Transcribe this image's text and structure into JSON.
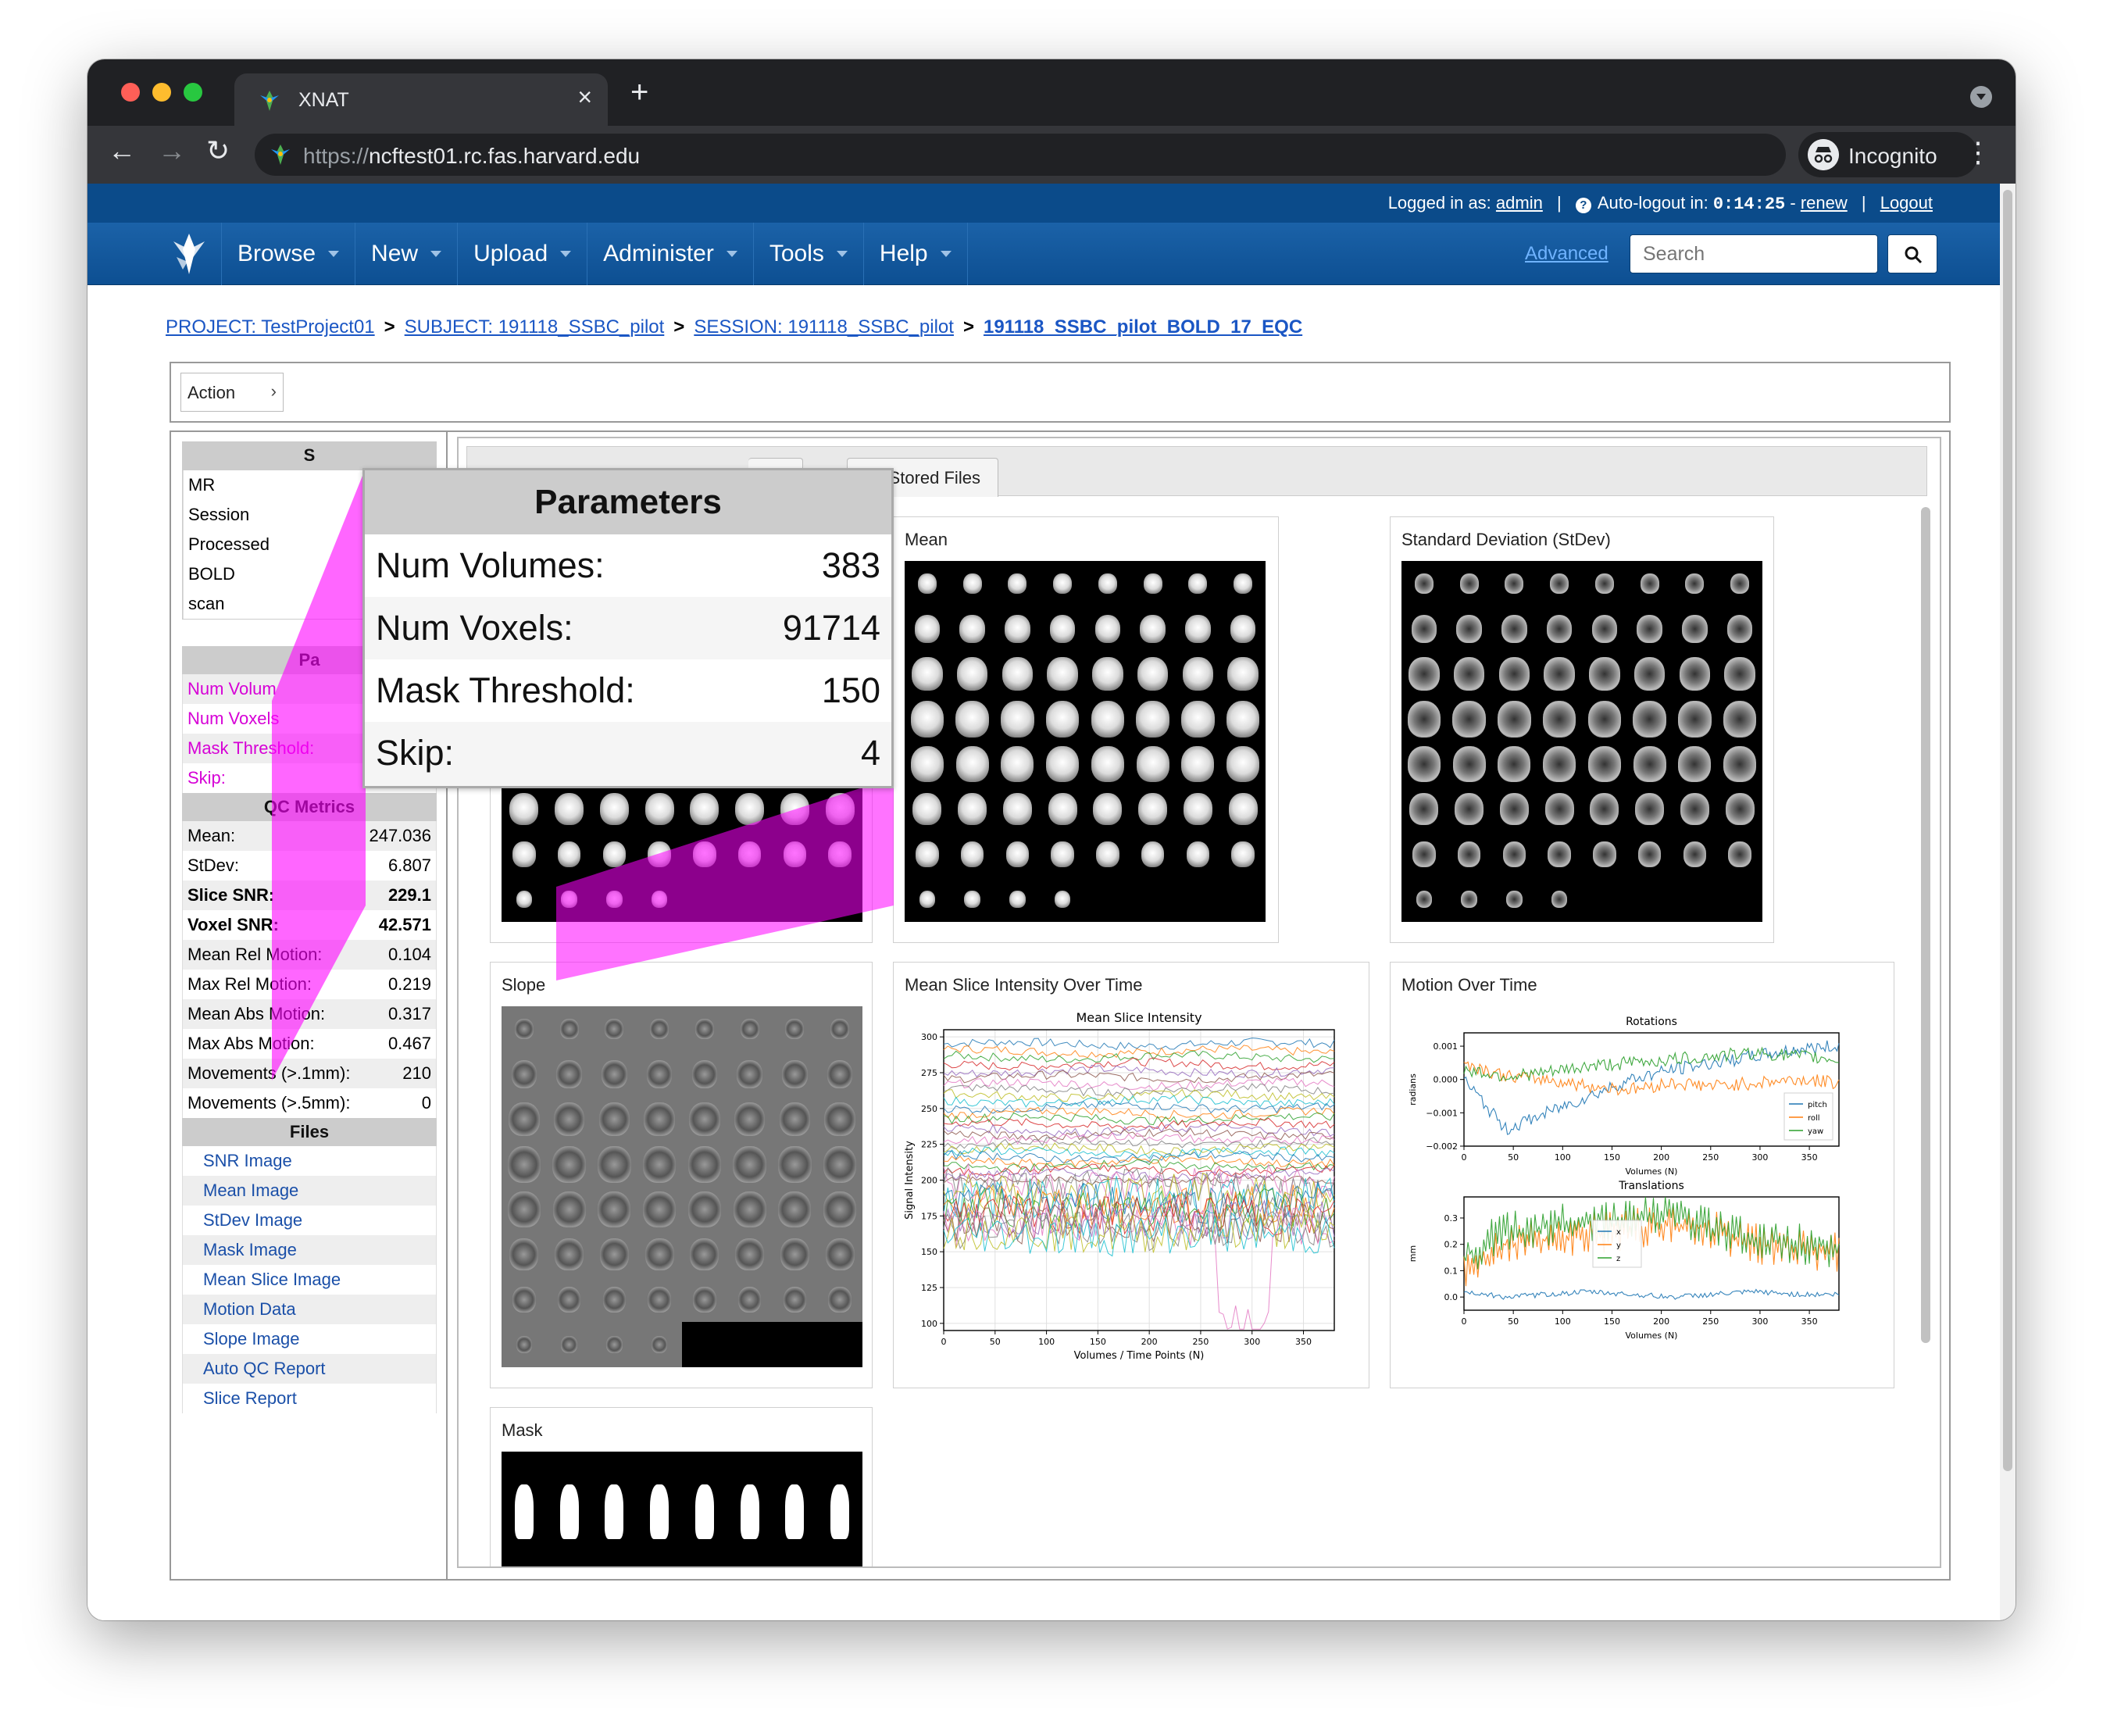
{
  "browser": {
    "tab_title": "XNAT",
    "url_scheme": "https://",
    "url_host": "ncftest01.rc.fas.harvard.edu",
    "incognito_label": "Incognito"
  },
  "topbar": {
    "logged_in_label": "Logged in as:",
    "user": "admin",
    "autologout_label": "Auto-logout in:",
    "timer": "0:14:25",
    "renew": "renew",
    "logout": "Logout"
  },
  "nav": {
    "items": [
      {
        "label": "Browse"
      },
      {
        "label": "New"
      },
      {
        "label": "Upload"
      },
      {
        "label": "Administer"
      },
      {
        "label": "Tools"
      },
      {
        "label": "Help"
      }
    ],
    "advanced": "Advanced",
    "search_placeholder": "Search"
  },
  "breadcrumb": {
    "project": "PROJECT: TestProject01",
    "subject": "SUBJECT: 191118_SSBC_pilot",
    "session": "SESSION: 191118_SSBC_pilot",
    "current": "191118_SSBC_pilot_BOLD_17_EQC",
    "sep": ">"
  },
  "action": {
    "label": "Action"
  },
  "summary": {
    "header": "S",
    "lines": [
      "MR",
      "Session",
      "Processed",
      "BOLD",
      "scan"
    ]
  },
  "parameters": {
    "header": "Pa",
    "rows": [
      {
        "label": "Num Volum",
        "value": ""
      },
      {
        "label": "Num Voxels",
        "value": ""
      },
      {
        "label": "Mask Threshold:",
        "value": "150"
      },
      {
        "label": "Skip:",
        "value": "4"
      }
    ]
  },
  "qc_metrics": {
    "header": "QC Metrics",
    "rows": [
      {
        "label": "Mean:",
        "value": "247.036",
        "bold": false
      },
      {
        "label": "StDev:",
        "value": "6.807",
        "bold": false
      },
      {
        "label": "Slice SNR:",
        "value": "229.1",
        "bold": true
      },
      {
        "label": "Voxel SNR:",
        "value": "42.571",
        "bold": true
      },
      {
        "label": "Mean Rel Motion:",
        "value": "0.104",
        "bold": false
      },
      {
        "label": "Max Rel Motion:",
        "value": "0.219",
        "bold": false
      },
      {
        "label": "Mean Abs Motion:",
        "value": "0.317",
        "bold": false
      },
      {
        "label": "Max Abs Motion:",
        "value": "0.467",
        "bold": false
      },
      {
        "label": "Movements (>.1mm):",
        "value": "210",
        "bold": false
      },
      {
        "label": "Movements (>.5mm):",
        "value": "0",
        "bold": false
      }
    ]
  },
  "files": {
    "header": "Files",
    "items": [
      "SNR Image",
      "Mean Image",
      "StDev Image",
      "Mask Image",
      "Mean Slice Image",
      "Motion Data",
      "Slope Image",
      "Auto QC Report",
      "Slice Report"
    ]
  },
  "tabs": {
    "partial": "QC",
    "stored": "All Stored Files"
  },
  "callout": {
    "header": "Parameters",
    "rows": [
      {
        "label": "Num Volumes:",
        "value": "383"
      },
      {
        "label": "Num Voxels:",
        "value": "91714"
      },
      {
        "label": "Mask Threshold:",
        "value": "150"
      },
      {
        "label": "Skip:",
        "value": "4"
      }
    ]
  },
  "cards": {
    "mean": "Mean",
    "stdev": "Standard Deviation (StDev)",
    "slope": "Slope",
    "msi": "Mean Slice Intensity Over Time",
    "motion": "Motion Over Time",
    "mask": "Mask"
  },
  "chart_data": [
    {
      "type": "line",
      "title": "Mean Slice Intensity",
      "xlabel": "Volumes / Time Points (N)",
      "ylabel": "Signal Intensity",
      "xlim": [
        0,
        380
      ],
      "ylim": [
        95,
        305
      ],
      "x_ticks": [
        0,
        50,
        100,
        150,
        200,
        250,
        300,
        350
      ],
      "y_ticks": [
        100,
        125,
        150,
        175,
        200,
        225,
        250,
        275,
        300
      ],
      "series_count": 40,
      "series_levels": [
        295,
        290,
        286,
        281,
        276,
        272,
        267,
        263,
        259,
        255,
        251,
        247,
        243,
        239,
        235,
        232,
        229,
        226,
        222,
        219,
        216,
        213,
        210,
        207,
        204,
        200,
        197,
        194,
        191,
        188,
        185,
        182,
        179,
        176,
        173,
        170,
        168,
        166,
        164,
        162
      ],
      "grid": true
    },
    {
      "type": "line",
      "title": "Rotations",
      "xlabel": "Volumes (N)",
      "ylabel": "radians",
      "xlim": [
        0,
        380
      ],
      "ylim": [
        -0.002,
        0.0014
      ],
      "x_ticks": [
        0,
        50,
        100,
        150,
        200,
        250,
        300,
        350
      ],
      "y_ticks": [
        "-0.002",
        "-0.001",
        "0.000",
        "0.001"
      ],
      "series": [
        {
          "name": "pitch",
          "color": "#1f77b4",
          "values": [
            0.0,
            -0.0015,
            -0.001,
            -0.0005,
            0.0,
            0.0003,
            0.0005,
            0.0007,
            0.0009,
            0.001
          ]
        },
        {
          "name": "roll",
          "color": "#ff7f0e",
          "values": [
            0.0005,
            0.0001,
            0.0,
            -0.0002,
            -0.0003,
            -0.0001,
            -0.0002,
            -0.0001,
            0.0,
            -0.0001
          ]
        },
        {
          "name": "yaw",
          "color": "#2ca02c",
          "values": [
            0.0003,
            0.0001,
            0.0002,
            0.0004,
            0.0005,
            0.0006,
            0.0007,
            0.0008,
            0.0007,
            0.0006
          ]
        }
      ],
      "legend": "bottom-right"
    },
    {
      "type": "line",
      "title": "Translations",
      "xlabel": "Volumes (N)",
      "ylabel": "mm",
      "xlim": [
        0,
        380
      ],
      "ylim": [
        -0.05,
        0.38
      ],
      "x_ticks": [
        0,
        50,
        100,
        150,
        200,
        250,
        300,
        350
      ],
      "y_ticks": [
        "0.0",
        "0.1",
        "0.2",
        "0.3"
      ],
      "series": [
        {
          "name": "x",
          "color": "#1f77b4",
          "values": [
            0.02,
            0.0,
            0.01,
            0.02,
            0.01,
            0.0,
            0.01,
            0.02,
            0.01,
            0.01
          ]
        },
        {
          "name": "y",
          "color": "#ff7f0e",
          "values": [
            0.1,
            0.2,
            0.22,
            0.24,
            0.26,
            0.28,
            0.25,
            0.2,
            0.18,
            0.17
          ]
        },
        {
          "name": "z",
          "color": "#2ca02c",
          "values": [
            0.15,
            0.25,
            0.27,
            0.29,
            0.3,
            0.31,
            0.26,
            0.22,
            0.2,
            0.19
          ]
        }
      ],
      "legend": "center"
    }
  ]
}
